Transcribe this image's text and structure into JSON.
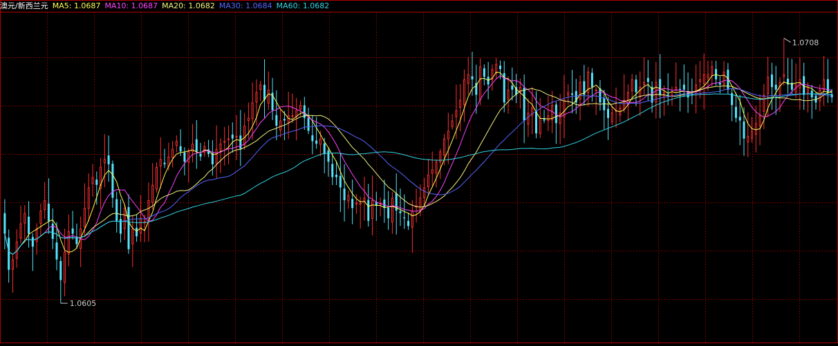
{
  "chart_data": {
    "type": "candlestick",
    "symbol": "澳元/新西兰元",
    "ylim": [
      1.059,
      1.0718
    ],
    "high_annotation": "1.0708",
    "low_annotation": "1.0605",
    "moving_averages": [
      {
        "name": "MA5",
        "value": "1.0687",
        "color": "#ffff55",
        "period": 5
      },
      {
        "name": "MA10",
        "value": "1.0687",
        "color": "#ff44ff",
        "period": 10
      },
      {
        "name": "MA20",
        "value": "1.0682",
        "color": "#f5f580",
        "period": 20
      },
      {
        "name": "MA30",
        "value": "1.0684",
        "color": "#5566ff",
        "period": 30
      },
      {
        "name": "MA60",
        "value": "1.0682",
        "color": "#33d6e6",
        "period": 60
      }
    ],
    "colors": {
      "up": "#ff3030",
      "down": "#55e6ff",
      "grid": "#7a0000",
      "border": "#b00000",
      "label": "#cccccc"
    },
    "closes": [
      1.0632,
      1.0618,
      1.0622,
      1.0629,
      1.0636,
      1.064,
      1.0632,
      1.0627,
      1.0634,
      1.0641,
      1.0645,
      1.0637,
      1.063,
      1.0622,
      1.0614,
      1.0625,
      1.0633,
      1.0632,
      1.0628,
      1.0634,
      1.0642,
      1.065,
      1.0654,
      1.0651,
      1.0658,
      1.0661,
      1.0659,
      1.0646,
      1.0637,
      1.0632,
      1.0642,
      1.0626,
      1.0634,
      1.0631,
      1.0638,
      1.0637,
      1.0645,
      1.0651,
      1.0658,
      1.0661,
      1.0659,
      1.0662,
      1.0665,
      1.0668,
      1.0664,
      1.066,
      1.0664,
      1.0667,
      1.0664,
      1.0662,
      1.0666,
      1.0663,
      1.0659,
      1.0665,
      1.0667,
      1.0668,
      1.0669,
      1.0669,
      1.067,
      1.0665,
      1.0674,
      1.0677,
      1.0683,
      1.0687,
      1.069,
      1.0684,
      1.0688,
      1.068,
      1.0674,
      1.0676,
      1.0676,
      1.0678,
      1.0678,
      1.068,
      1.0682,
      1.0677,
      1.0672,
      1.0668,
      1.0667,
      1.0669,
      1.0663,
      1.066,
      1.0654,
      1.0654,
      1.065,
      1.0645,
      1.0647,
      1.0642,
      1.0644,
      1.0644,
      1.0646,
      1.0637,
      1.0645,
      1.0643,
      1.0644,
      1.0642,
      1.0638,
      1.0646,
      1.0641,
      1.064,
      1.0638,
      1.0635,
      1.0641,
      1.0643,
      1.0646,
      1.065,
      1.0655,
      1.0657,
      1.066,
      1.0664,
      1.0669,
      1.0672,
      1.0676,
      1.068,
      1.0684,
      1.0692,
      1.0694,
      1.0692,
      1.0686,
      1.0697,
      1.0693,
      1.069,
      1.0696,
      1.0698,
      1.0696,
      1.0683,
      1.0688,
      1.0688,
      1.0686,
      1.0689,
      1.0676,
      1.0679,
      1.0681,
      1.0671,
      1.0677,
      1.0676,
      1.0678,
      1.0682,
      1.0675,
      1.0679,
      1.0684,
      1.0687,
      1.0686,
      1.0683,
      1.0691,
      1.0686,
      1.0695,
      1.0689,
      1.0688,
      1.0683,
      1.068,
      1.0677,
      1.0679,
      1.068,
      1.0681,
      1.0684,
      1.0687,
      1.0692,
      1.0687,
      1.0689,
      1.0691,
      1.0691,
      1.0683,
      1.0691,
      1.0686,
      1.0687,
      1.0686,
      1.0686,
      1.0689,
      1.0688,
      1.0688,
      1.0685,
      1.0686,
      1.069,
      1.0692,
      1.0694,
      1.0694,
      1.0697,
      1.0692,
      1.069,
      1.0695,
      1.0688,
      1.0682,
      1.0677,
      1.0676,
      1.0669,
      1.067,
      1.0672,
      1.0675,
      1.0678,
      1.0686,
      1.0693,
      1.0689,
      1.0688,
      1.0691,
      1.0694,
      1.069,
      1.0688,
      1.069,
      1.0692,
      1.0686,
      1.0689,
      1.0685,
      1.0683,
      1.0688,
      1.0692,
      1.0687,
      1.0685
    ]
  }
}
